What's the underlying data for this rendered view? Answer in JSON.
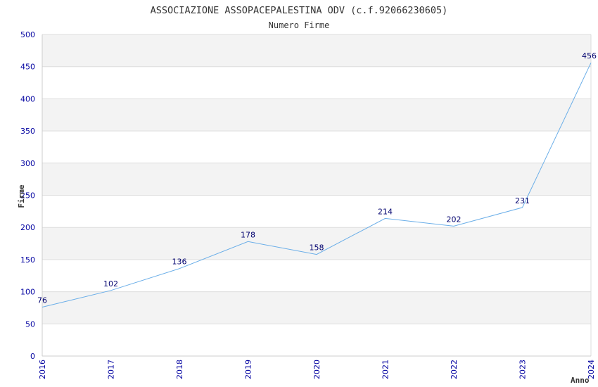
{
  "chart_data": {
    "type": "line",
    "title": "ASSOCIAZIONE ASSOPACEPALESTINA ODV (c.f.92066230605)",
    "subtitle": "Numero Firme",
    "xlabel": "Anno",
    "ylabel": "Firme",
    "x": [
      "2016",
      "2017",
      "2018",
      "2019",
      "2020",
      "2021",
      "2022",
      "2023",
      "2024"
    ],
    "values": [
      76,
      102,
      136,
      178,
      158,
      214,
      202,
      231,
      456
    ],
    "data_labels": [
      "76",
      "102",
      "136",
      "178",
      "158",
      "214",
      "202",
      "231",
      "456"
    ],
    "ylim": [
      0,
      500
    ],
    "yticks": [
      "0",
      "50",
      "100",
      "150",
      "200",
      "250",
      "300",
      "350",
      "400",
      "450",
      "500"
    ],
    "grid": true,
    "colors": {
      "line": "#6aaee8",
      "tick_labels": "#0000a0",
      "data_labels": "#00006e",
      "band": "#f3f3f3",
      "grid": "#dddddd",
      "title": "#333333"
    }
  }
}
